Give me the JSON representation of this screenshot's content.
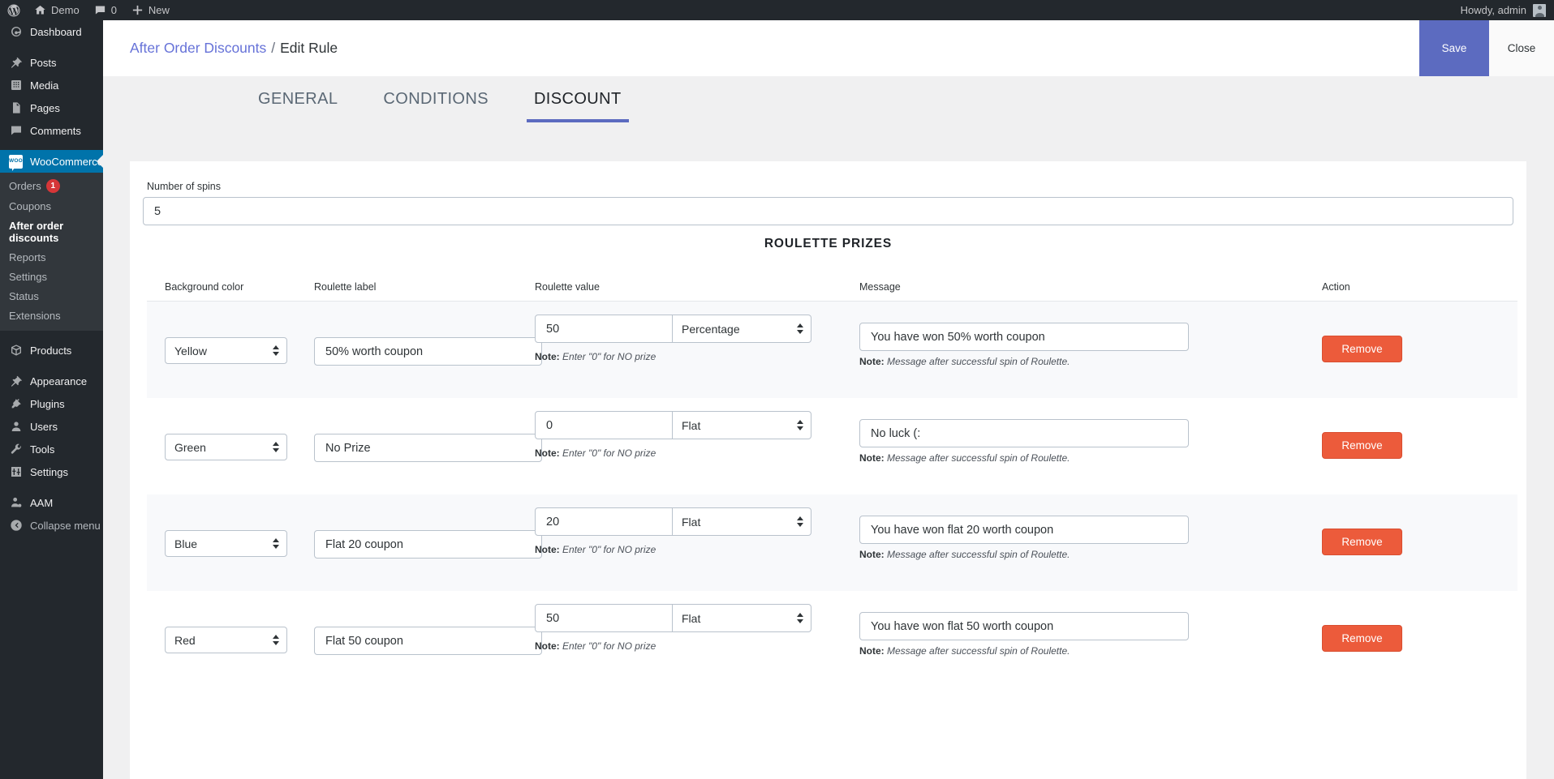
{
  "adminbar": {
    "logo_icon": "wordpress-logo-icon",
    "site_icon": "home-icon",
    "site_name": "Demo",
    "comments_icon": "comment-bubble-icon",
    "comments_count": "0",
    "new_icon": "plus-icon",
    "new_label": "New",
    "howdy": "Howdy, admin",
    "avatar_icon": "user-avatar-icon"
  },
  "sidebar": {
    "items": [
      {
        "label": "Dashboard",
        "icon": "dashboard-gauge-icon"
      },
      {
        "label": "Posts",
        "icon": "pin-icon"
      },
      {
        "label": "Media",
        "icon": "media-icon"
      },
      {
        "label": "Pages",
        "icon": "page-icon"
      },
      {
        "label": "Comments",
        "icon": "comment-bubble-icon"
      },
      {
        "label": "WooCommerce",
        "icon": "woocommerce-icon"
      },
      {
        "label": "Products",
        "icon": "products-box-icon"
      },
      {
        "label": "Appearance",
        "icon": "appearance-brush-icon"
      },
      {
        "label": "Plugins",
        "icon": "plugins-plug-icon"
      },
      {
        "label": "Users",
        "icon": "users-icon"
      },
      {
        "label": "Tools",
        "icon": "tools-wrench-icon"
      },
      {
        "label": "Settings",
        "icon": "settings-sliders-icon"
      },
      {
        "label": "AAM",
        "icon": "aam-user-icon"
      },
      {
        "label": "Collapse menu",
        "icon": "collapse-arrow-icon"
      }
    ],
    "woo_submenu": [
      {
        "label": "Orders",
        "badge": "1"
      },
      {
        "label": "Coupons",
        "badge": ""
      },
      {
        "label": "After order discounts",
        "badge": ""
      },
      {
        "label": "Reports",
        "badge": ""
      },
      {
        "label": "Settings",
        "badge": ""
      },
      {
        "label": "Status",
        "badge": ""
      },
      {
        "label": "Extensions",
        "badge": ""
      }
    ]
  },
  "header": {
    "breadcrumb_parent": "After Order Discounts",
    "breadcrumb_sep": "/",
    "breadcrumb_current": "Edit Rule",
    "save_label": "Save",
    "close_label": "Close"
  },
  "tabs": [
    {
      "label": "GENERAL"
    },
    {
      "label": "CONDITIONS"
    },
    {
      "label": "DISCOUNT"
    }
  ],
  "discount": {
    "spins_label": "Number of spins",
    "spins_value": "5",
    "prizes_title": "ROULETTE PRIZES",
    "columns": {
      "background": "Background color",
      "label": "Roulette label",
      "value": "Roulette value",
      "message": "Message",
      "action": "Action"
    },
    "note_value_prefix": "Note:",
    "note_value_text": "Enter \"0\" for NO prize",
    "note_message_prefix": "Note:",
    "note_message_text": "Message after successful spin of Roulette.",
    "remove_label": "Remove",
    "rows": [
      {
        "color": "Yellow",
        "label": "50% worth coupon",
        "value": "50",
        "type": "Percentage",
        "message": "You have won 50% worth coupon"
      },
      {
        "color": "Green",
        "label": "No Prize",
        "value": "0",
        "type": "Flat",
        "message": "No luck (:"
      },
      {
        "color": "Blue",
        "label": "Flat 20 coupon",
        "value": "20",
        "type": "Flat",
        "message": "You have won flat 20 worth coupon"
      },
      {
        "color": "Red",
        "label": "Flat 50 coupon",
        "value": "50",
        "type": "Flat",
        "message": "You have won flat 50 worth coupon"
      }
    ]
  },
  "colors": {
    "accent": "#5c6bc0",
    "link": "#6672d8",
    "danger": "#ec5b3b",
    "admin_bg": "#23282d",
    "woo_active": "#0073aa",
    "badge": "#d63638"
  }
}
